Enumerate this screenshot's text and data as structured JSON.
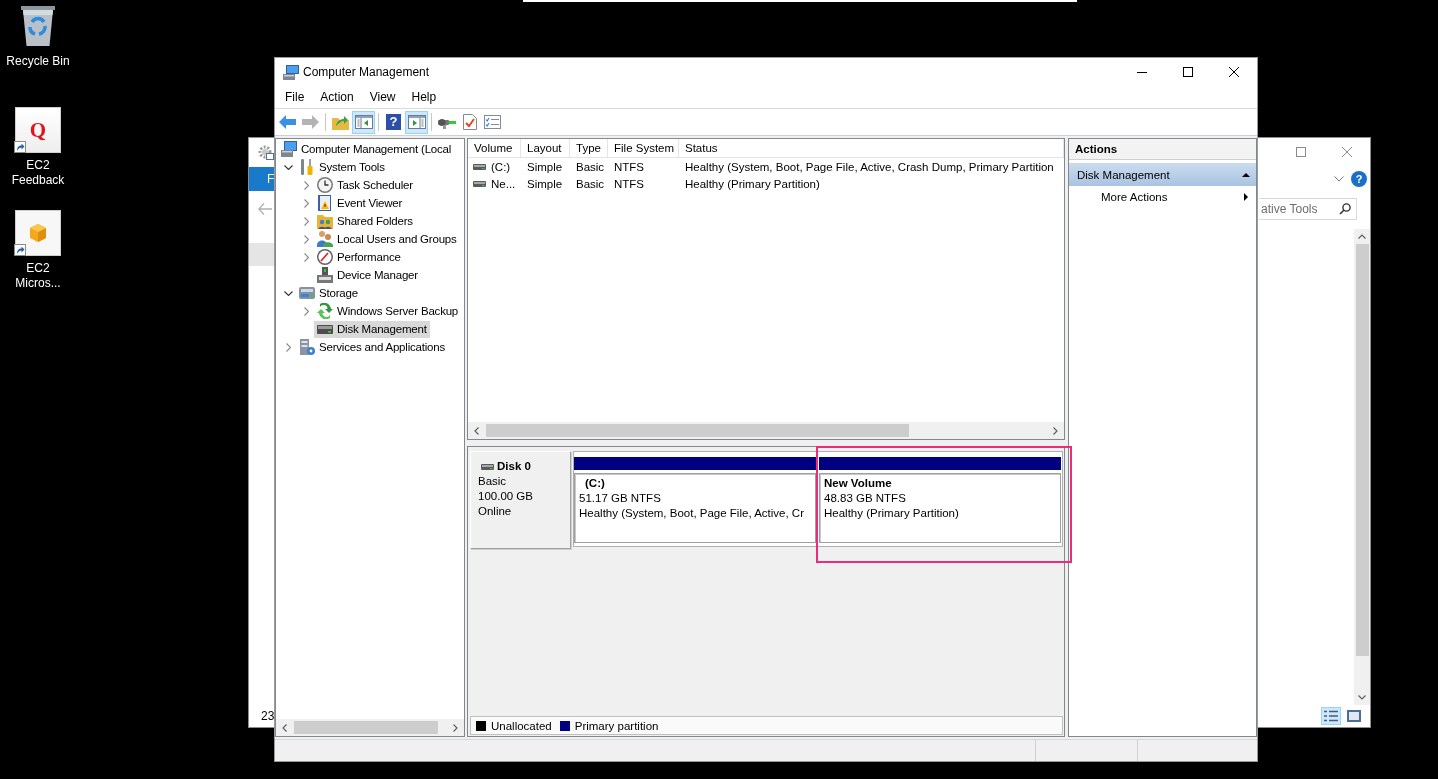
{
  "desktop": {
    "icons": [
      {
        "label": "Recycle Bin",
        "kind": "recycle-bin",
        "shortcut": false
      },
      {
        "label": "EC2 Feedback",
        "kind": "letter-tile",
        "glyph": "Q",
        "shortcut": true
      },
      {
        "label": "EC2 Micros...",
        "kind": "cube-tile",
        "shortcut": true
      }
    ]
  },
  "background_window": {
    "ribbon_tab": "F",
    "help_glyph": "?",
    "search": {
      "placeholder": "ative Tools"
    },
    "status_text": "23",
    "views": [
      {
        "kind": "details",
        "selected": true
      },
      {
        "kind": "large-icons",
        "selected": false
      }
    ]
  },
  "window": {
    "title": "Computer Management",
    "menu": [
      "File",
      "Action",
      "View",
      "Help"
    ],
    "toolbar": [
      {
        "buttons": [
          {
            "kind": "back",
            "disabled": false
          },
          {
            "kind": "forward",
            "disabled": true
          }
        ]
      },
      {
        "buttons": [
          {
            "kind": "up-folder",
            "disabled": false
          },
          {
            "kind": "console-tree",
            "disabled": false,
            "pressed": true
          }
        ]
      },
      {
        "buttons": [
          {
            "kind": "help",
            "glyph": "?",
            "disabled": false
          },
          {
            "kind": "action-pane",
            "disabled": false,
            "pressed": true
          }
        ]
      },
      {
        "buttons": [
          {
            "kind": "connect",
            "disabled": false
          },
          {
            "kind": "properties",
            "disabled": false
          },
          {
            "kind": "checklist",
            "disabled": false
          }
        ]
      }
    ],
    "tree": [
      {
        "label": "Computer Management (Local",
        "kind": "computer",
        "expandable": false,
        "selected": false,
        "children": [
          {
            "label": "System Tools",
            "kind": "tools",
            "expandable": true,
            "expanded": true,
            "selected": false,
            "children": [
              {
                "label": "Task Scheduler",
                "kind": "clock",
                "expandable": true,
                "expanded": false,
                "selected": false
              },
              {
                "label": "Event Viewer",
                "kind": "event-log",
                "expandable": true,
                "expanded": false,
                "selected": false
              },
              {
                "label": "Shared Folders",
                "kind": "shared-folder",
                "expandable": true,
                "expanded": false,
                "selected": false
              },
              {
                "label": "Local Users and Groups",
                "kind": "users",
                "expandable": true,
                "expanded": false,
                "selected": false
              },
              {
                "label": "Performance",
                "kind": "performance",
                "expandable": true,
                "expanded": false,
                "selected": false
              },
              {
                "label": "Device Manager",
                "kind": "device",
                "expandable": false,
                "selected": false
              }
            ]
          },
          {
            "label": "Storage",
            "kind": "storage",
            "expandable": true,
            "expanded": true,
            "selected": false,
            "children": [
              {
                "label": "Windows Server Backup",
                "kind": "backup",
                "expandable": true,
                "expanded": false,
                "selected": false
              },
              {
                "label": "Disk Management",
                "kind": "disk",
                "expandable": false,
                "selected": true
              }
            ]
          },
          {
            "label": "Services and Applications",
            "kind": "services",
            "expandable": true,
            "expanded": false,
            "selected": false
          }
        ]
      }
    ],
    "volumes": {
      "columns": [
        "Volume",
        "Layout",
        "Type",
        "File System",
        "Status"
      ],
      "rows": [
        {
          "cells": [
            "(C:)",
            "Simple",
            "Basic",
            "NTFS",
            "Healthy (System, Boot, Page File, Active, Crash Dump, Primary Partition"
          ]
        },
        {
          "cells": [
            "Ne...",
            "Simple",
            "Basic",
            "NTFS",
            "Healthy (Primary Partition)"
          ]
        }
      ]
    },
    "disks": [
      {
        "name": "Disk 0",
        "type": "Basic",
        "size": "100.00 GB",
        "status": "Online",
        "partitions": [
          {
            "name": "(C:)",
            "size": "51.17 GB NTFS",
            "status": "Healthy (System, Boot, Page File, Active, Cr",
            "kind": "primary",
            "highlighted": false
          },
          {
            "name": "New Volume",
            "size": "48.83 GB NTFS",
            "status": "Healthy (Primary Partition)",
            "kind": "primary",
            "highlighted": true
          }
        ]
      }
    ],
    "legend": [
      {
        "label": "Unallocated",
        "kind": "unallocated",
        "color": "#000000"
      },
      {
        "label": "Primary partition",
        "kind": "primary",
        "color": "#000080"
      }
    ],
    "actions": {
      "title": "Actions",
      "sections": [
        {
          "title": "Disk Management",
          "expanded": true,
          "items": [
            {
              "label": "More Actions",
              "submenu": true
            }
          ]
        }
      ]
    }
  }
}
